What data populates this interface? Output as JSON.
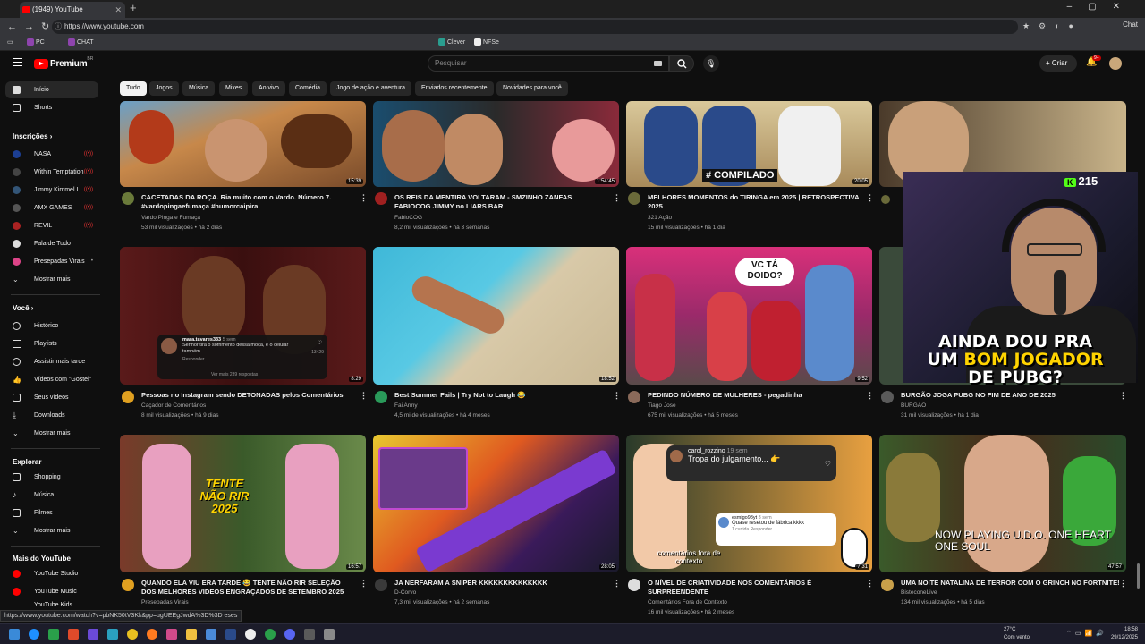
{
  "browser": {
    "tab_title": "(1949) YouTube",
    "url": "https://www.youtube.com",
    "chat_label": "Chat",
    "bookmarks": [
      "PC",
      "CHAT",
      "Clever",
      "NFSe"
    ]
  },
  "header": {
    "logo_text": "Premium",
    "logo_region": "BR",
    "search_placeholder": "Pesquisar",
    "create_label": "Criar",
    "notif_badge": "9+"
  },
  "sidebar": {
    "main": [
      {
        "label": "Início",
        "icon": "home-icon"
      },
      {
        "label": "Shorts",
        "icon": "shorts-icon"
      }
    ],
    "subs_title": "Inscrições",
    "subs": [
      {
        "label": "NASA",
        "color": "#1c3f94",
        "live": true
      },
      {
        "label": "Within Temptation",
        "color": "#444444",
        "live": true
      },
      {
        "label": "Jimmy Kimmel L...",
        "color": "#335577",
        "live": true
      },
      {
        "label": "AMX GAMES",
        "color": "#555555",
        "live": true
      },
      {
        "label": "REVIL",
        "color": "#aa2222",
        "live": true
      },
      {
        "label": "Fala de Tudo",
        "color": "#dddddd",
        "live": false
      },
      {
        "label": "Presepadas Virais",
        "color": "#dd4488",
        "live": false,
        "dot": true
      }
    ],
    "show_more": "Mostrar mais",
    "you_title": "Você",
    "you": [
      {
        "label": "Histórico",
        "icon": "history-icon"
      },
      {
        "label": "Playlists",
        "icon": "playlists-icon"
      },
      {
        "label": "Assistir mais tarde",
        "icon": "watch-later-icon"
      },
      {
        "label": "Vídeos com \"Gostei\"",
        "icon": "like-icon"
      },
      {
        "label": "Seus vídeos",
        "icon": "your-videos-icon"
      },
      {
        "label": "Downloads",
        "icon": "download-icon"
      }
    ],
    "explore_title": "Explorar",
    "explore": [
      {
        "label": "Shopping",
        "icon": "shopping-icon"
      },
      {
        "label": "Música",
        "icon": "music-icon"
      },
      {
        "label": "Filmes",
        "icon": "movies-icon"
      }
    ],
    "more_title": "Mais do YouTube",
    "more": [
      {
        "label": "YouTube Studio"
      },
      {
        "label": "YouTube Music"
      },
      {
        "label": "YouTube Kids"
      }
    ]
  },
  "chips": [
    "Tudo",
    "Jogos",
    "Música",
    "Mixes",
    "Ao vivo",
    "Comédia",
    "Jogo de ação e aventura",
    "Enviados recentemente",
    "Novidades para você"
  ],
  "videos": [
    {
      "title": "CACETADAS DA ROÇA. Ria muito com o Vardo. Número 7. #vardopingaefumaça #humorcaipira",
      "channel": "Vardo Pinga e Fumaça",
      "meta": "53 mil visualizações • há 2 dias",
      "duration": "15:39"
    },
    {
      "title": "OS REIS DA MENTIRA VOLTARAM - SMZINHO ZANFAS FABIOCOG JIMMY no LIARS BAR",
      "channel": "FabioCOG",
      "meta": "8,2 mil visualizações • há 3 semanas",
      "duration": "1:54:45"
    },
    {
      "title": "MELHORES MOMENTOS do TIRINGA em 2025 | RETROSPECTIVA 2025",
      "channel": "321 Ação",
      "meta": "15 mil visualizações • há 1 dia",
      "duration": "20:05",
      "thumb_text": "# COMPILADO"
    },
    {
      "title": "",
      "channel": "",
      "meta": "",
      "duration": ""
    },
    {
      "title": "Pessoas no Instagram sendo DETONADAS pelos Comentários",
      "channel": "Caçador de Comentários",
      "meta": "8 mil visualizações • há 9 dias",
      "duration": "8:29",
      "comment_user": "mara.tavares333",
      "comment_time": "5 sem",
      "comment_text": "Senhor tira o sofrimento dessa moça, e o celular também.",
      "comment_reply": "Responder",
      "comment_likes": "13429",
      "comment_more": "Ver mais 239 respostas"
    },
    {
      "title": "Best Summer Fails | Try Not to Laugh 😂",
      "channel": "FailArmy",
      "meta": "4,5 mi de visualizações • há 4 meses",
      "duration": "18:52"
    },
    {
      "title": "PEDINDO NÚMERO DE MULHERES - pegadinha",
      "channel": "Tiago Jose",
      "meta": "675 mil visualizações • há 5 meses",
      "duration": "9:52",
      "thumb_text": "VC TÁ DOIDO?"
    },
    {
      "title": "BURGÃO JOGA PUBG NO FIM DE ANO DE 2025",
      "channel": "BURGÃO",
      "meta": "31 mil visualizações • há 1 dia",
      "duration": ""
    },
    {
      "title": "QUANDO ELA VIU ERA TARDE 😂 TENTE NÃO RIR SELEÇÃO DOS MELHORES VIDEOS ENGRAÇADOS DE SETEMBRO 2025",
      "channel": "Presepadas Virais",
      "meta": "",
      "duration": "16:57",
      "thumb_text": "TENTE NÃO RIR 2025"
    },
    {
      "title": "JA NERFARAM A SNIPER KKKKKKKKKKKKKK",
      "channel": "D-Corvo",
      "meta": "7,3 mil visualizações • há 2 semanas",
      "duration": "28:05"
    },
    {
      "title": "O NÍVEL DE CRIATIVIDADE NOS COMENTÁRIOS É SURPREENDENTE",
      "channel": "Comentários Fora de Contexto",
      "meta": "16 mil visualizações • há 2 meses",
      "duration": "7:31",
      "comment_user": "carol_rozzino",
      "comment_time": "19 sem",
      "comment_text": "Tropa do julgamento... 👉",
      "comment2_user": "esmigo98yt",
      "comment2_time": "3 sem",
      "comment2_text": "Quase resetou de fábrica kkkk",
      "comment2_meta": "1 curtida   Responder",
      "thumb_text": "comentários fora de contexto"
    },
    {
      "title": "UMA NOITE NATALINA DE TERROR COM O GRINCH NO FORTNITE!",
      "channel": "BisteconeLive",
      "meta": "134 mil visualizações • há 5 dias",
      "duration": "47:57",
      "thumb_text": "NOW PLAYING U.D.O. ONE HEART ONE SOUL"
    }
  ],
  "overlay": {
    "viewer_count": "215",
    "caption_line1": "AINDA DOU PRA",
    "caption_line2a": "UM ",
    "caption_line2b": "BOM JOGADOR",
    "caption_line3": "DE PUBG?"
  },
  "status_url": "https://www.youtube.com/watch?v=pbNK50tV3Kk&pp=ugUEEgJwdA%3D%3D",
  "status_suffix": "eses",
  "taskbar": {
    "weather_temp": "27°C",
    "weather_desc": "Com vento",
    "time": "18:58",
    "date": "29/12/2025"
  }
}
